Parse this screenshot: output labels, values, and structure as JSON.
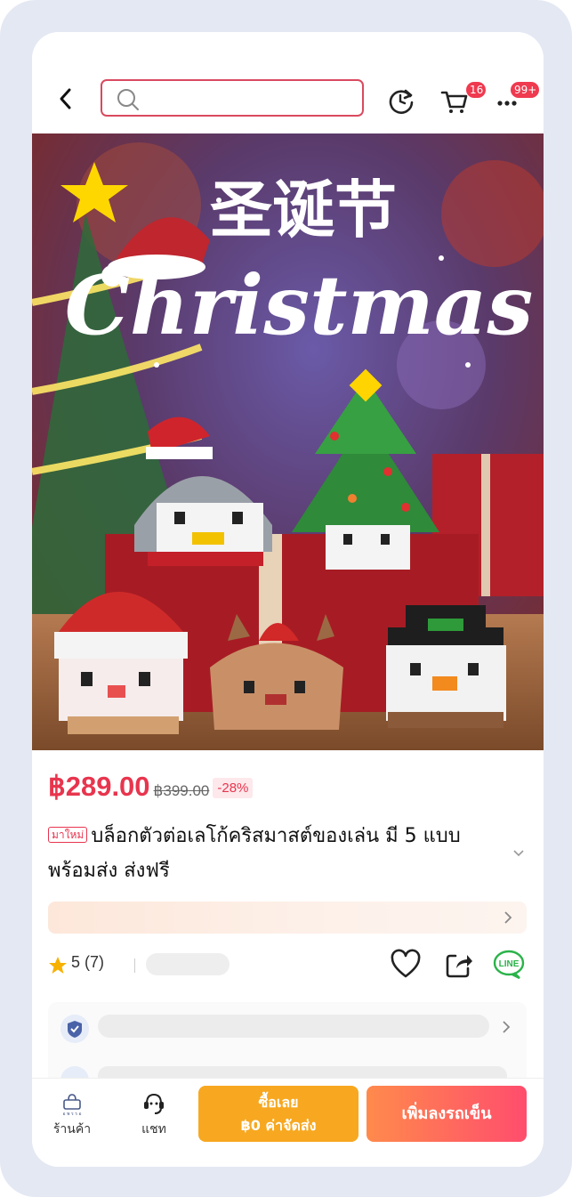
{
  "search": {
    "placeholder": ""
  },
  "header": {
    "cart_badge": "16",
    "more_badge": "99+"
  },
  "hero": {
    "headline_cn": "圣诞节",
    "headline_en": "Christmas"
  },
  "product": {
    "price": "฿289.00",
    "original_price": "฿399.00",
    "discount": "-28%",
    "new_tag": "มาใหม่",
    "title": "บล็อกตัวต่อเลโก้คริสมาสต์ของเล่น มี 5 แบบ พร้อมส่ง ส่งฟรี",
    "rating_text": "5 (7)"
  },
  "bottom_bar": {
    "store_label": "ร้านค้า",
    "chat_label": "แชท",
    "buy_now_line1": "ซื้อเลย",
    "buy_now_line2": "฿0 ค่าจัดส่ง",
    "add_to_cart": "เพิ่มลงรถเข็น"
  },
  "colors": {
    "accent": "#e8354e",
    "buy_button": "#f7a820",
    "cart_gradient_start": "#ff8a4c",
    "cart_gradient_end": "#ff4d6d",
    "line_green": "#2bb34a"
  }
}
